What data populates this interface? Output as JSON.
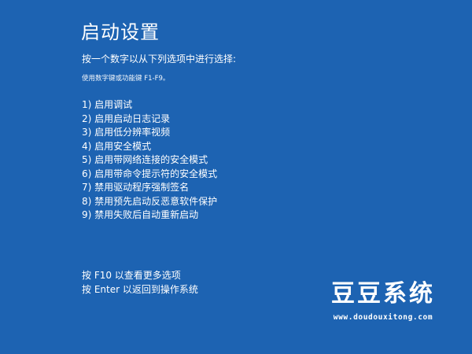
{
  "screen": {
    "title": "启动设置",
    "prompt": "按一个数字以从下列选项中进行选择:",
    "hint": "使用数字键或功能键 F1-F9。",
    "options": [
      "1) 启用调试",
      "2) 启用启动日志记录",
      "3) 启用低分辨率视频",
      "4) 启用安全模式",
      "5) 启用带网络连接的安全模式",
      "6) 启用带命令提示符的安全模式",
      "7) 禁用驱动程序强制签名",
      "8) 禁用预先启动反恶意软件保护",
      "9) 禁用失败后自动重新启动"
    ],
    "footer": {
      "more_options": "按 F10 以查看更多选项",
      "return_to_os": "按 Enter 以返回到操作系统"
    }
  },
  "watermark": {
    "title": "豆豆系统",
    "url": "www.doudouxitong.com"
  },
  "colors": {
    "background": "#1d63b2",
    "text": "#ffffff"
  }
}
